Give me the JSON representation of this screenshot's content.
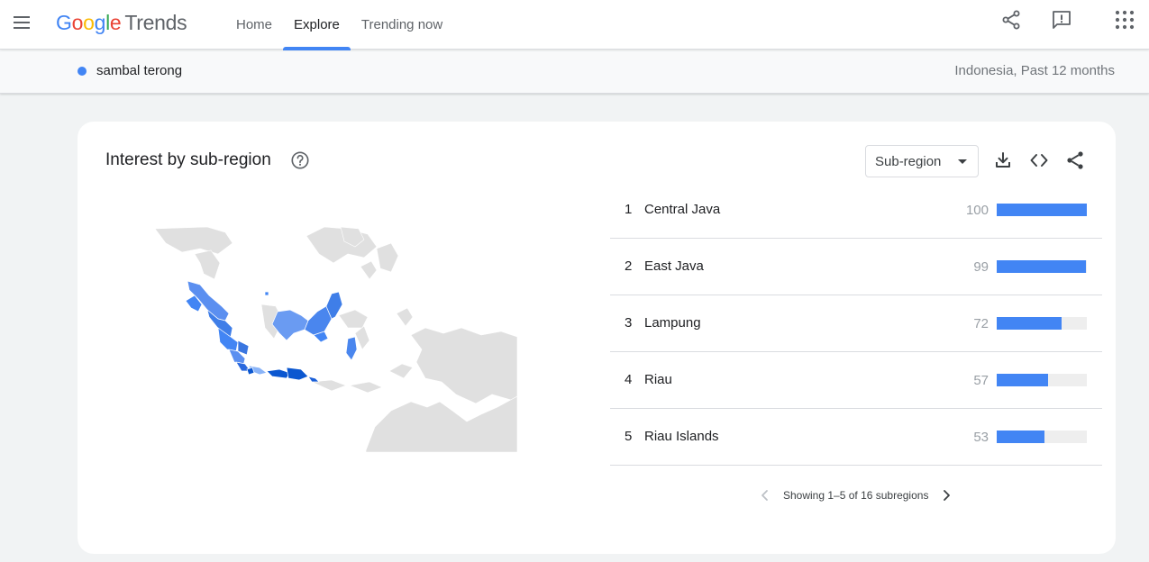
{
  "header": {
    "logo": {
      "google": [
        "G",
        "o",
        "o",
        "g",
        "l",
        "e"
      ],
      "google_colors": [
        "#4285f4",
        "#ea4335",
        "#fbbc05",
        "#4285f4",
        "#34a853",
        "#ea4335"
      ],
      "product": "Trends"
    },
    "nav": [
      {
        "label": "Home",
        "active": false
      },
      {
        "label": "Explore",
        "active": true
      },
      {
        "label": "Trending now",
        "active": false
      }
    ],
    "icons": {
      "menu": "menu-icon",
      "share": "share-icon",
      "feedback": "feedback-icon",
      "apps": "apps-grid-icon"
    }
  },
  "search": {
    "term": "sambal terong",
    "term_color": "#4285f4",
    "meta": "Indonesia, Past 12 months"
  },
  "region_card": {
    "title": "Interest by sub-region",
    "help_icon": "help-icon",
    "selector_value": "Sub-region",
    "actions": [
      "download-icon",
      "embed-code-icon",
      "share-icon"
    ],
    "rows": [
      {
        "rank": "1",
        "name": "Central Java",
        "value": 100
      },
      {
        "rank": "2",
        "name": "East Java",
        "value": 99
      },
      {
        "rank": "3",
        "name": "Lampung",
        "value": 72
      },
      {
        "rank": "4",
        "name": "Riau",
        "value": 57
      },
      {
        "rank": "5",
        "name": "Riau Islands",
        "value": 53
      }
    ],
    "pager_text": "Showing 1–5 of 16 subregions",
    "colors": {
      "bar": "#4285f4",
      "track": "#eeeeee",
      "map_high": "#0b57d0",
      "map_mid": "#4285f4",
      "map_low": "#8ab4f8",
      "map_none": "#e0e0e0"
    }
  }
}
